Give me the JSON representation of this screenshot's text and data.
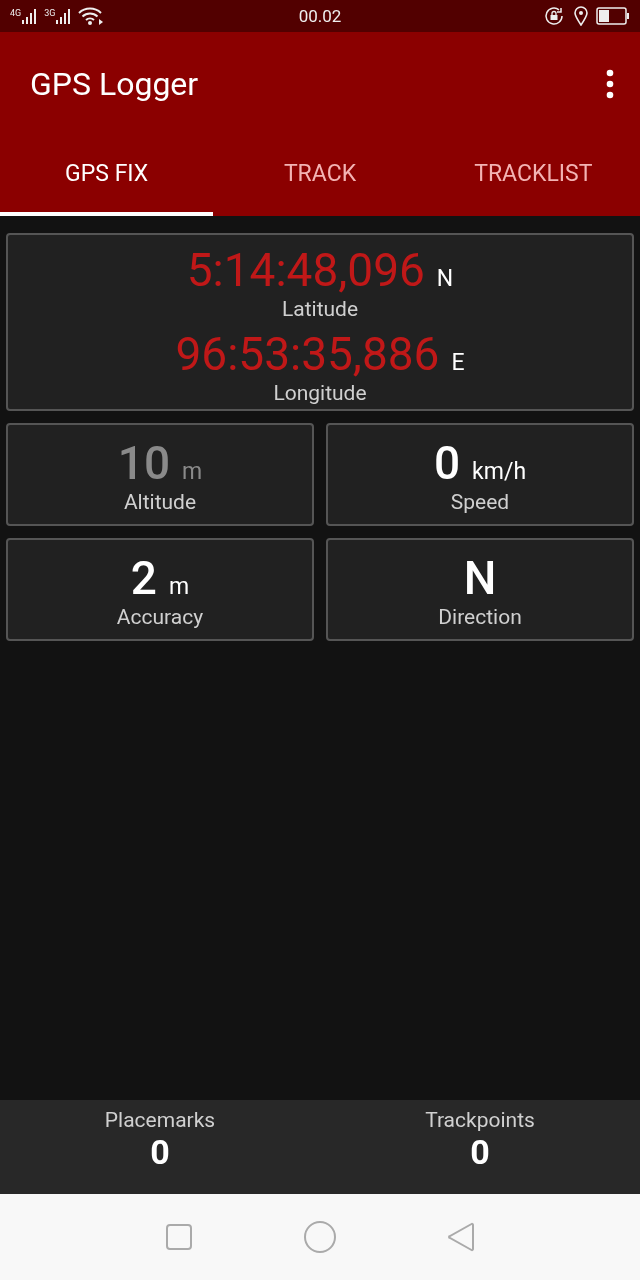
{
  "status_bar": {
    "networks": [
      "4G",
      "3G"
    ],
    "time": "00.02"
  },
  "app_bar": {
    "title": "GPS Logger"
  },
  "tabs": [
    {
      "label": "GPS FIX",
      "selected": true
    },
    {
      "label": "TRACK",
      "selected": false
    },
    {
      "label": "TRACKLIST",
      "selected": false
    }
  ],
  "coordinates": [
    {
      "value": "5:14:48,096",
      "hemisphere": "N",
      "label": "Latitude"
    },
    {
      "value": "96:53:35,886",
      "hemisphere": "E",
      "label": "Longitude"
    }
  ],
  "readings": [
    {
      "value": "10",
      "unit": "m",
      "label": "Altitude",
      "dimmed": true
    },
    {
      "value": "0",
      "unit": "km/h",
      "label": "Speed",
      "dimmed": false
    },
    {
      "value": "2",
      "unit": "m",
      "label": "Accuracy",
      "dimmed": false
    },
    {
      "value": "N",
      "label": "Direction",
      "dimmed": false
    }
  ],
  "counters": [
    {
      "label": "Placemarks",
      "value": "0"
    },
    {
      "label": "Trackpoints",
      "value": "0"
    }
  ]
}
